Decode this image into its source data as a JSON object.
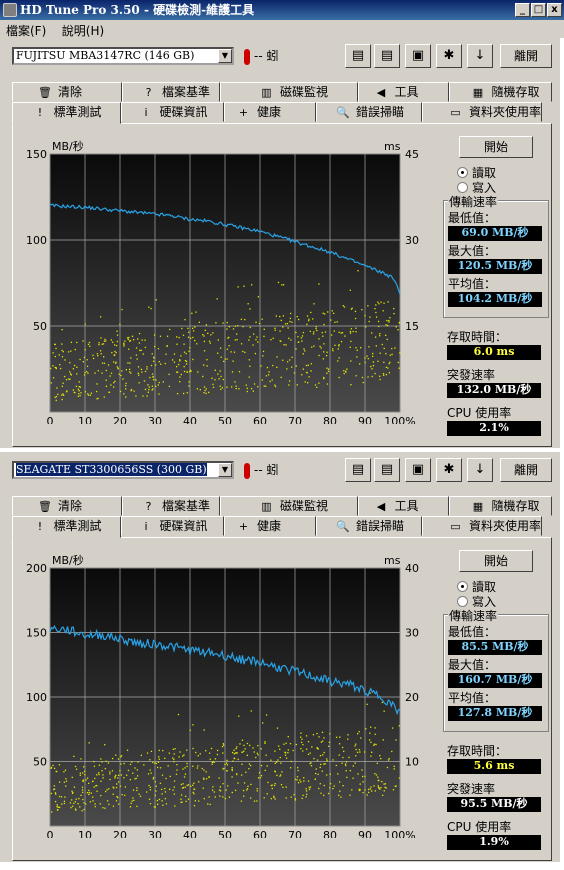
{
  "app": {
    "title": "HD Tune Pro 3.50 - 硬碟檢測-維護工具"
  },
  "menu": [
    "檔案(F)",
    "說明(H)"
  ],
  "window_buttons": [
    "_",
    "□",
    "x"
  ],
  "tabs_top": [
    "清除",
    "檔案基準",
    "磁碟監視",
    "工具",
    "隨機存取"
  ],
  "tabs_bottom": [
    "標準測試",
    "硬碟資訊",
    "健康",
    "錯誤掃瞄",
    "資料夾使用率"
  ],
  "toolbar": {
    "temp": "-- 蚓",
    "exit": "離開"
  },
  "labels": {
    "start": "開始",
    "read": "讀取",
    "write": "寫入",
    "transfer_rate": "傳輸速率",
    "min": "最低值：",
    "max": "最大值：",
    "avg": "平均值：",
    "access_time": "存取時間：",
    "burst_rate": "突發速率",
    "cpu": "CPU 使用率",
    "unit_left": "MB/秒",
    "unit_right": "ms"
  },
  "panels": [
    {
      "drive": "FUJITSU MBA3147RC (146 GB)",
      "min": "69.0 MB/秒",
      "max": "120.5 MB/秒",
      "avg": "104.2 MB/秒",
      "access": "6.0 ms",
      "burst": "132.0 MB/秒",
      "cpu": "2.1%",
      "chart_data": {
        "type": "line",
        "xlabel": "",
        "ylabel": "MB/秒",
        "y_ticks": [
          "150",
          "100",
          "50"
        ],
        "y2_ticks": [
          "45",
          "30",
          "15"
        ],
        "x_ticks": [
          "0",
          "10",
          "20",
          "30",
          "40",
          "50",
          "60",
          "70",
          "80",
          "90",
          "100%"
        ],
        "ylim": [
          0,
          150
        ],
        "y2lim": [
          0,
          45
        ],
        "xlim": [
          0,
          100
        ],
        "series": [
          {
            "name": "",
            "color": "#29a3e6",
            "x": [
              0,
              10,
              20,
              25,
              30,
              35,
              40,
              45,
              50,
              55,
              60,
              65,
              70,
              75,
              80,
              85,
              90,
              95,
              98,
              100
            ],
            "values": [
              120,
              119,
              117,
              116,
              115,
              114,
              112,
              111,
              109,
              107,
              105,
              102,
              99,
              96,
              93,
              89,
              85,
              81,
              78,
              69
            ]
          }
        ],
        "access_scatter": {
          "color": "#e6e600",
          "y_min_start": 2,
          "y_max_start": 12,
          "y_min_end": 5,
          "y_max_end": 20
        }
      }
    },
    {
      "drive": "SEAGATE ST3300656SS (300 GB)",
      "min": "85.5 MB/秒",
      "max": "160.7 MB/秒",
      "avg": "127.8 MB/秒",
      "access": "5.6 ms",
      "burst": "95.5 MB/秒",
      "cpu": "1.9%",
      "chart_data": {
        "type": "line",
        "xlabel": "",
        "ylabel": "MB/秒",
        "y_ticks": [
          "200",
          "150",
          "100",
          "50"
        ],
        "y2_ticks": [
          "40",
          "30",
          "20",
          "10"
        ],
        "x_ticks": [
          "0",
          "10",
          "20",
          "30",
          "40",
          "50",
          "60",
          "70",
          "80",
          "90",
          "100%"
        ],
        "ylim": [
          0,
          200
        ],
        "y2lim": [
          0,
          40
        ],
        "xlim": [
          0,
          100
        ],
        "series": [
          {
            "name": "",
            "color": "#29a3e6",
            "x": [
              0,
              5,
              10,
              15,
              20,
              25,
              30,
              35,
              40,
              45,
              50,
              55,
              60,
              65,
              70,
              75,
              80,
              85,
              90,
              95,
              100
            ],
            "values": [
              153,
              152,
              148,
              148,
              145,
              142,
              141,
              139,
              136,
              135,
              132,
              129,
              127,
              123,
              120,
              116,
              112,
              110,
              105,
              100,
              88
            ]
          }
        ],
        "access_scatter": {
          "color": "#e6e600",
          "y_min_start": 2,
          "y_max_start": 10,
          "y_min_end": 5,
          "y_max_end": 16
        }
      }
    }
  ]
}
